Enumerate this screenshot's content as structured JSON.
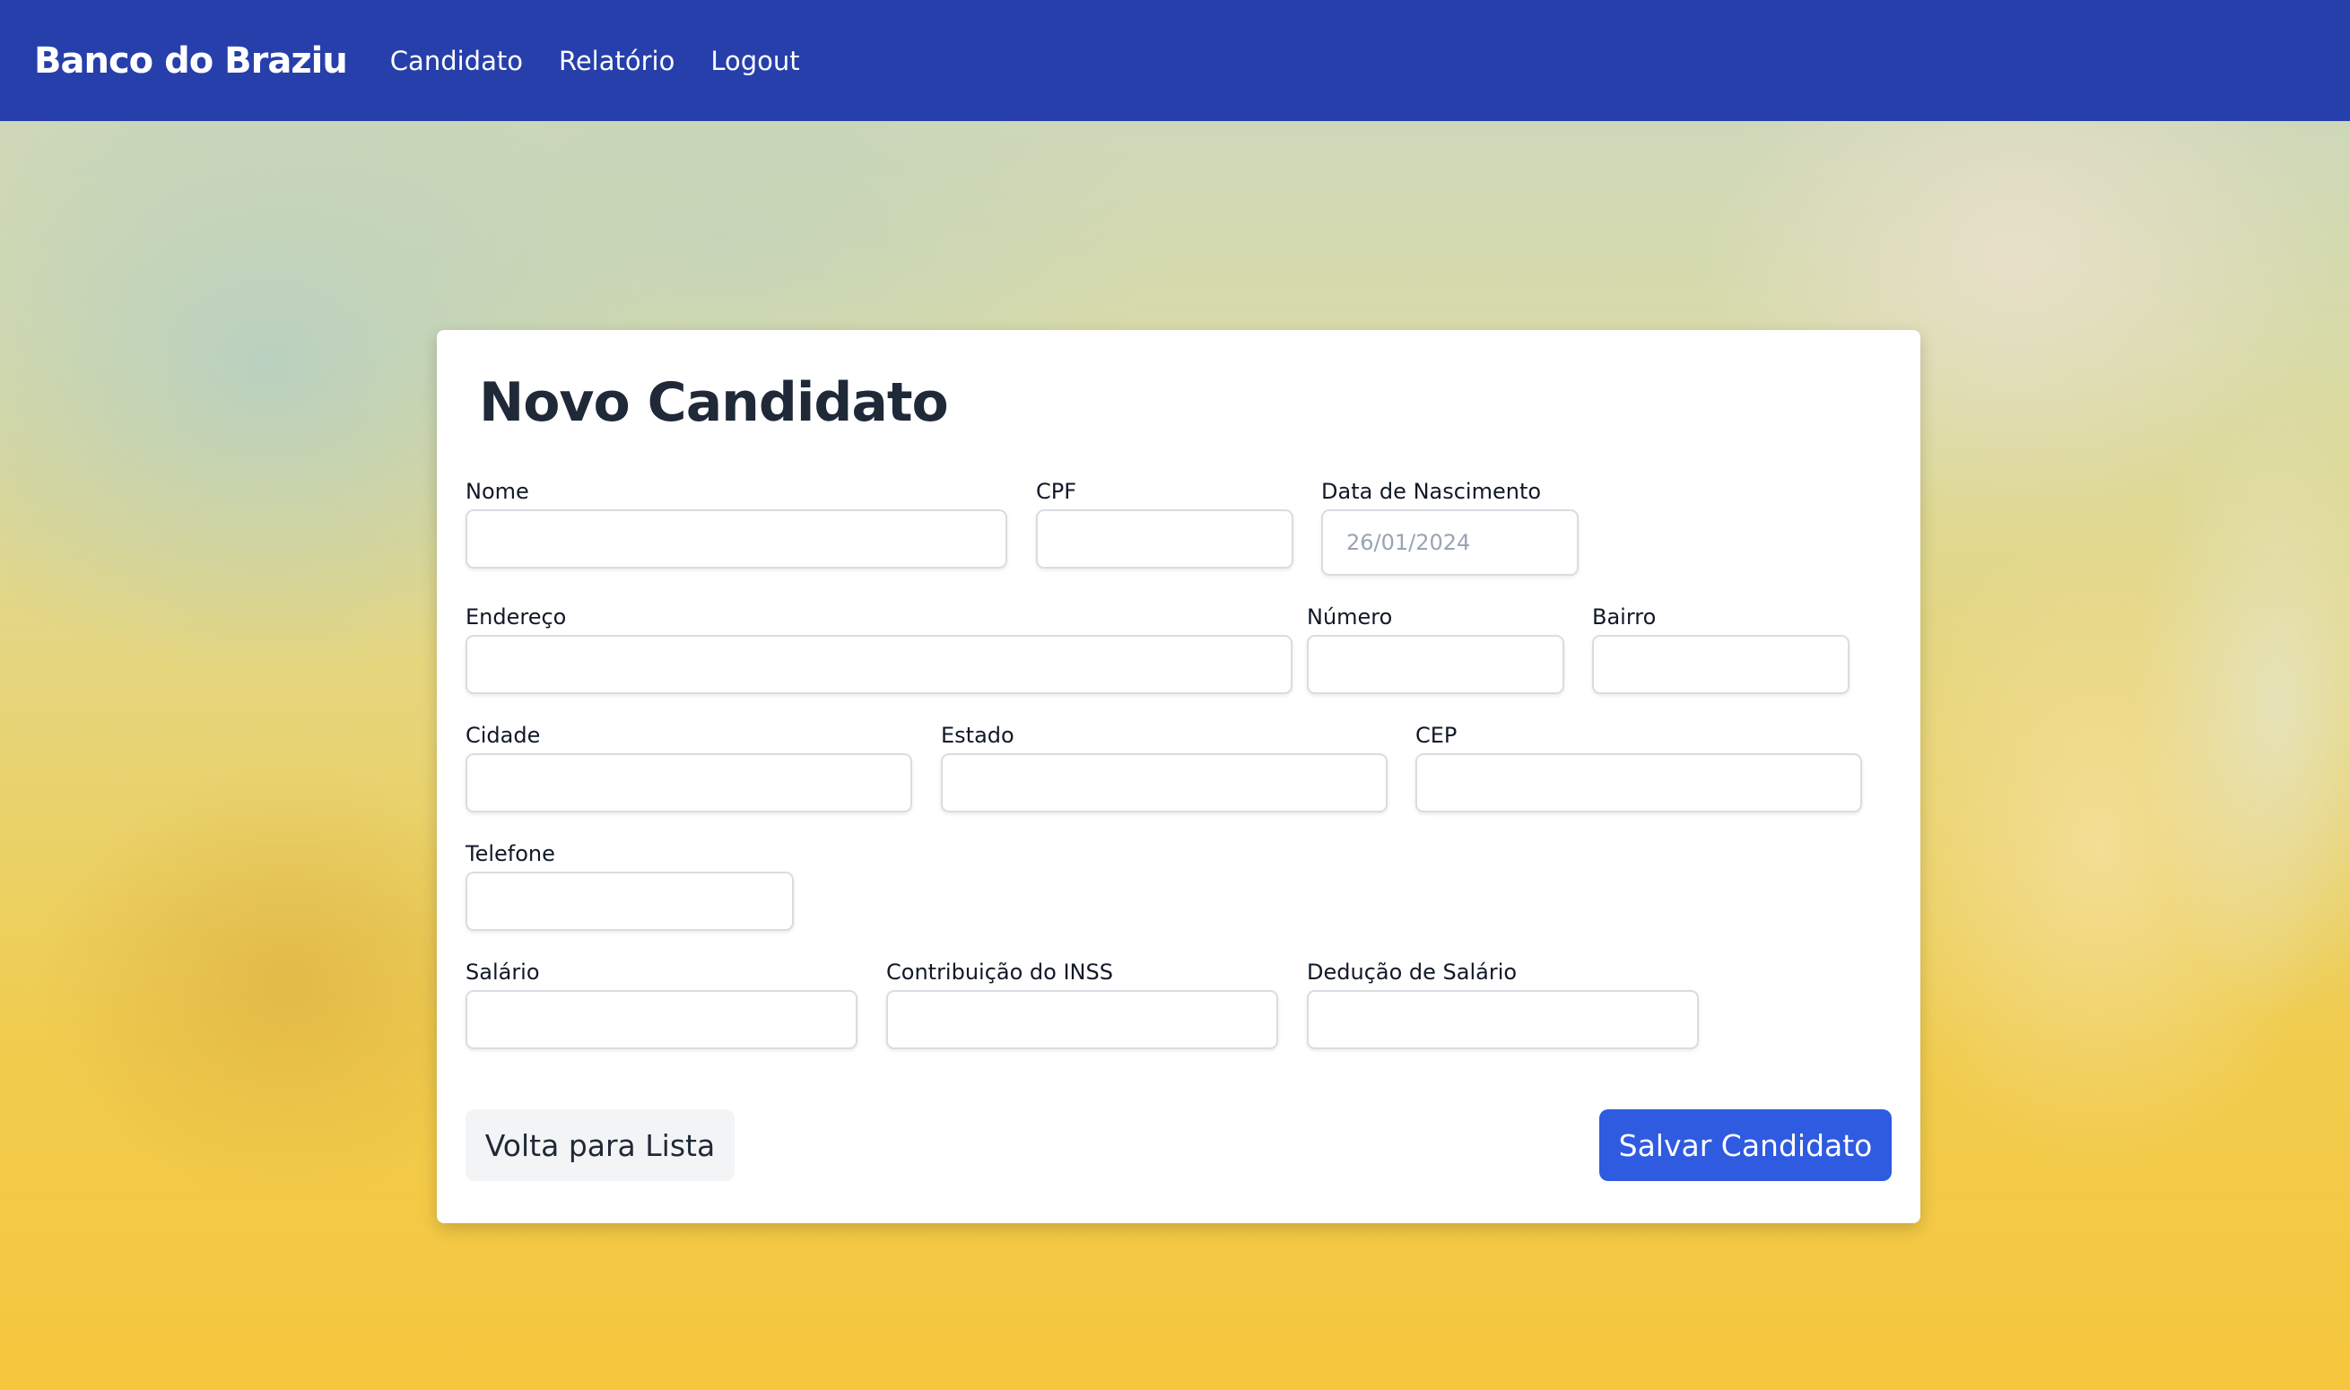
{
  "navbar": {
    "brand": "Banco do Braziu",
    "links": [
      "Candidato",
      "Relatório",
      "Logout"
    ]
  },
  "form": {
    "title": "Novo Candidato",
    "fields": {
      "nome": {
        "label": "Nome",
        "value": ""
      },
      "cpf": {
        "label": "CPF",
        "value": ""
      },
      "data_nascimento": {
        "label": "Data de Nascimento",
        "value": "26/01/2024"
      },
      "endereco": {
        "label": "Endereço",
        "value": ""
      },
      "numero": {
        "label": "Número",
        "value": ""
      },
      "bairro": {
        "label": "Bairro",
        "value": ""
      },
      "cidade": {
        "label": "Cidade",
        "value": ""
      },
      "estado": {
        "label": "Estado",
        "value": ""
      },
      "cep": {
        "label": "CEP",
        "value": ""
      },
      "telefone": {
        "label": "Telefone",
        "value": ""
      },
      "salario": {
        "label": "Salário",
        "value": ""
      },
      "inss": {
        "label": "Contribuição do INSS",
        "value": ""
      },
      "deducao": {
        "label": "Dedução de Salário",
        "value": ""
      }
    },
    "back_button": "Volta para Lista",
    "save_button": "Salvar Candidato"
  },
  "colors": {
    "navbar": "#263fab",
    "primary_button": "#2f5be0",
    "secondary_button": "#f3f4f6"
  }
}
